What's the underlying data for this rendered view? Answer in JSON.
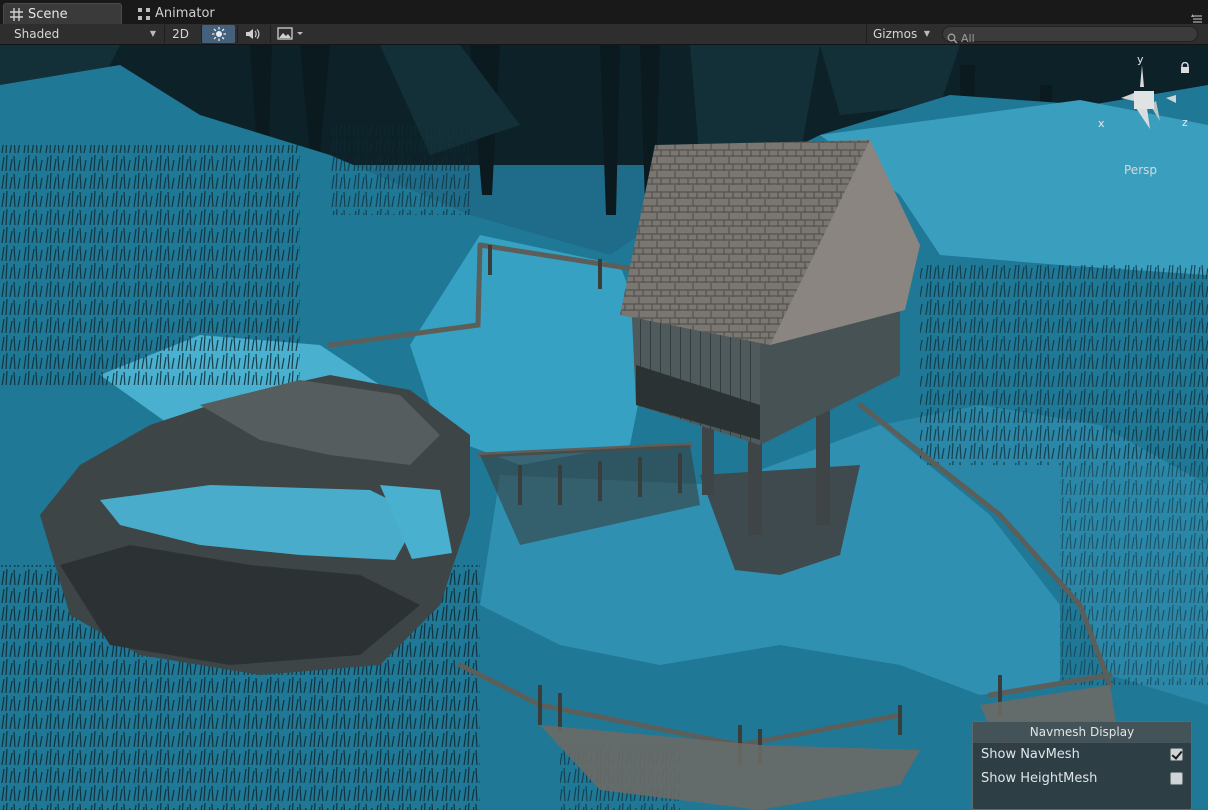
{
  "tabs": [
    {
      "label": "Scene",
      "icon": "grid-icon",
      "active": true
    },
    {
      "label": "Animator",
      "icon": "animator-icon",
      "active": false
    }
  ],
  "toolbar": {
    "shading_mode": "Shaded",
    "mode_2d": "2D",
    "lighting_icon": "sun-icon",
    "audio_icon": "speaker-icon",
    "effects_icon": "image-icon",
    "gizmos_label": "Gizmos",
    "search_placeholder": "All",
    "accent_color": "#44607a"
  },
  "orientation_gizmo": {
    "axis_y": "y",
    "axis_z": "z",
    "axis_x": "x",
    "projection": "Persp"
  },
  "navmesh_display": {
    "title": "Navmesh Display",
    "options": [
      {
        "label": "Show NavMesh",
        "checked": true
      },
      {
        "label": "Show HeightMesh",
        "checked": false
      }
    ]
  },
  "scene_colors": {
    "navmesh_overlay": "#1f6c8a",
    "snow_light": "#3aa8c8",
    "wood": "#6b6a66"
  }
}
